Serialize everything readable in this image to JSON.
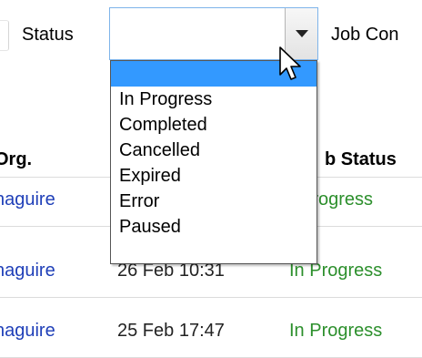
{
  "filter": {
    "status_label": "Status",
    "status_value": "",
    "next_label": "Job Con"
  },
  "dropdown": {
    "options": [
      "",
      "In Progress",
      "Completed",
      "Cancelled",
      "Expired",
      "Error",
      "Paused"
    ],
    "selected_index": 0
  },
  "table": {
    "headers": {
      "org": "Org.",
      "status": "b Status"
    },
    "rows": [
      {
        "org": "naguire",
        "date": "",
        "status": "Progress"
      },
      {
        "org": "naguire",
        "date": "26 Feb 10:31",
        "status": "In Progress"
      },
      {
        "org": "naguire",
        "date": "25 Feb 17:47",
        "status": "In Progress"
      }
    ]
  },
  "colors": {
    "selection": "#3399ff",
    "link": "#1f3fb8",
    "status_green": "#2c8f2c"
  },
  "icons": {
    "dropdown_arrow": "chevron-down-icon",
    "cursor": "mouse-cursor-icon"
  }
}
